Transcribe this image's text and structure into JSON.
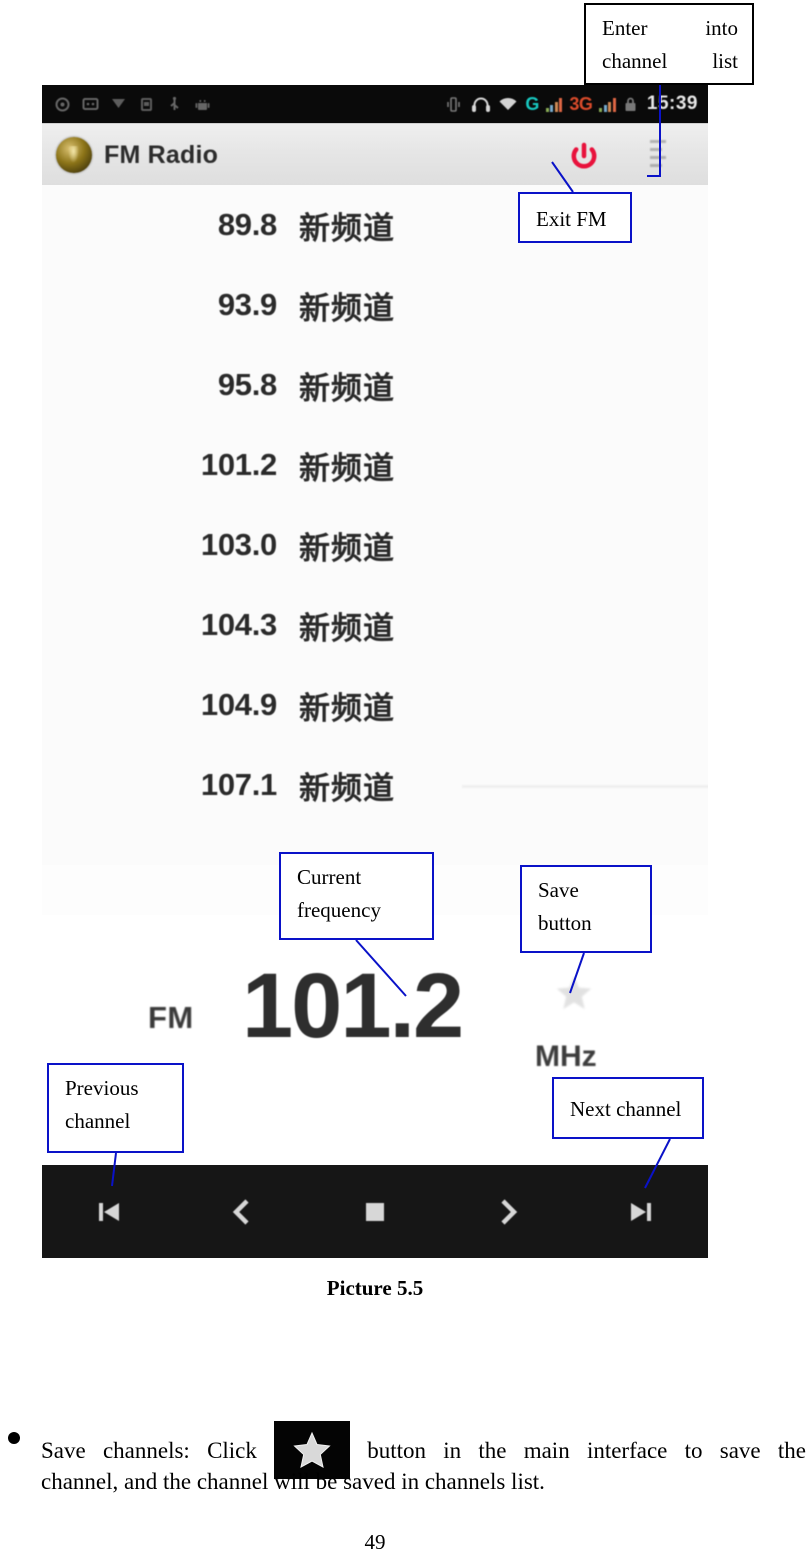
{
  "document": {
    "picture_caption": "Picture 5.5",
    "page_number": "49",
    "paragraph": {
      "bullet": "●",
      "line1_before": "Save   channels:   Click",
      "inline_icon": "star-save-button-icon",
      "line1_after": "button   in   the   main   interface   to   save   the",
      "line2": "channel, and the channel will be saved in channels list."
    }
  },
  "annotations": [
    {
      "id": "enter-into-channel-list",
      "text": "Enter         into channel list",
      "border_color": "#000000"
    },
    {
      "id": "exit-fm",
      "text": "Exit FM",
      "border_color": "#0a12c8"
    },
    {
      "id": "current-frequency",
      "text": "Current frequency",
      "border_color": "#0a12c8"
    },
    {
      "id": "save-button",
      "text": "Save button",
      "border_color": "#0a12c8"
    },
    {
      "id": "previous-channel",
      "text": "Previous channel",
      "border_color": "#0a12c8"
    },
    {
      "id": "next-channel",
      "text": "Next channel",
      "border_color": "#0a12c8"
    }
  ],
  "annotation_labels": {
    "enter_into_channel_list_1": "Enter",
    "enter_into_channel_list_2": "into",
    "enter_into_channel_list_3": "channel list",
    "exit_fm": "Exit FM",
    "current_frequency_1": "Current",
    "current_frequency_2": "frequency",
    "save_button_1": "Save",
    "save_button_2": "button",
    "previous_channel_1": "Previous",
    "previous_channel_2": "channel",
    "next_channel": "Next channel"
  },
  "screenshot": {
    "status_bar": {
      "time": "15:39",
      "network_g": "G",
      "network_3g": "3G",
      "icons": [
        "sync-icon",
        "message-icon",
        "download-icon",
        "sim-icon",
        "usb-icon",
        "android-icon",
        "vibrate-icon",
        "headset-icon",
        "wifi-icon",
        "signal-bars-icon",
        "lock-icon"
      ]
    },
    "app_bar": {
      "title": "FM Radio",
      "logo": "fm-radio-logo-icon",
      "power_icon": "power-off-icon",
      "menu_icon": "channel-list-menu-icon"
    },
    "channels": {
      "name_label": "新频道",
      "items": [
        {
          "frequency": "89.8",
          "name": "新频道"
        },
        {
          "frequency": "93.9",
          "name": "新频道"
        },
        {
          "frequency": "95.8",
          "name": "新频道"
        },
        {
          "frequency": "101.2",
          "name": "新频道"
        },
        {
          "frequency": "103.0",
          "name": "新频道"
        },
        {
          "frequency": "104.3",
          "name": "新频道"
        },
        {
          "frequency": "104.9",
          "name": "新频道"
        },
        {
          "frequency": "107.1",
          "name": "新频道"
        }
      ]
    },
    "tuner": {
      "band": "FM",
      "frequency": "101.2",
      "unit": "MHz",
      "save_icon": "star-save-icon"
    },
    "controls": [
      {
        "id": "previous-channel-button",
        "icon": "skip-previous-icon"
      },
      {
        "id": "seek-down-button",
        "icon": "chevron-left-icon"
      },
      {
        "id": "stop-button",
        "icon": "stop-square-icon"
      },
      {
        "id": "seek-up-button",
        "icon": "chevron-right-icon"
      },
      {
        "id": "next-channel-button",
        "icon": "skip-next-icon"
      }
    ]
  },
  "colors": {
    "annotation_blue": "#0a12c8",
    "power_red": "#e8123c",
    "status_bar_bg": "#0a0a0a",
    "control_bar_bg": "#161616"
  }
}
